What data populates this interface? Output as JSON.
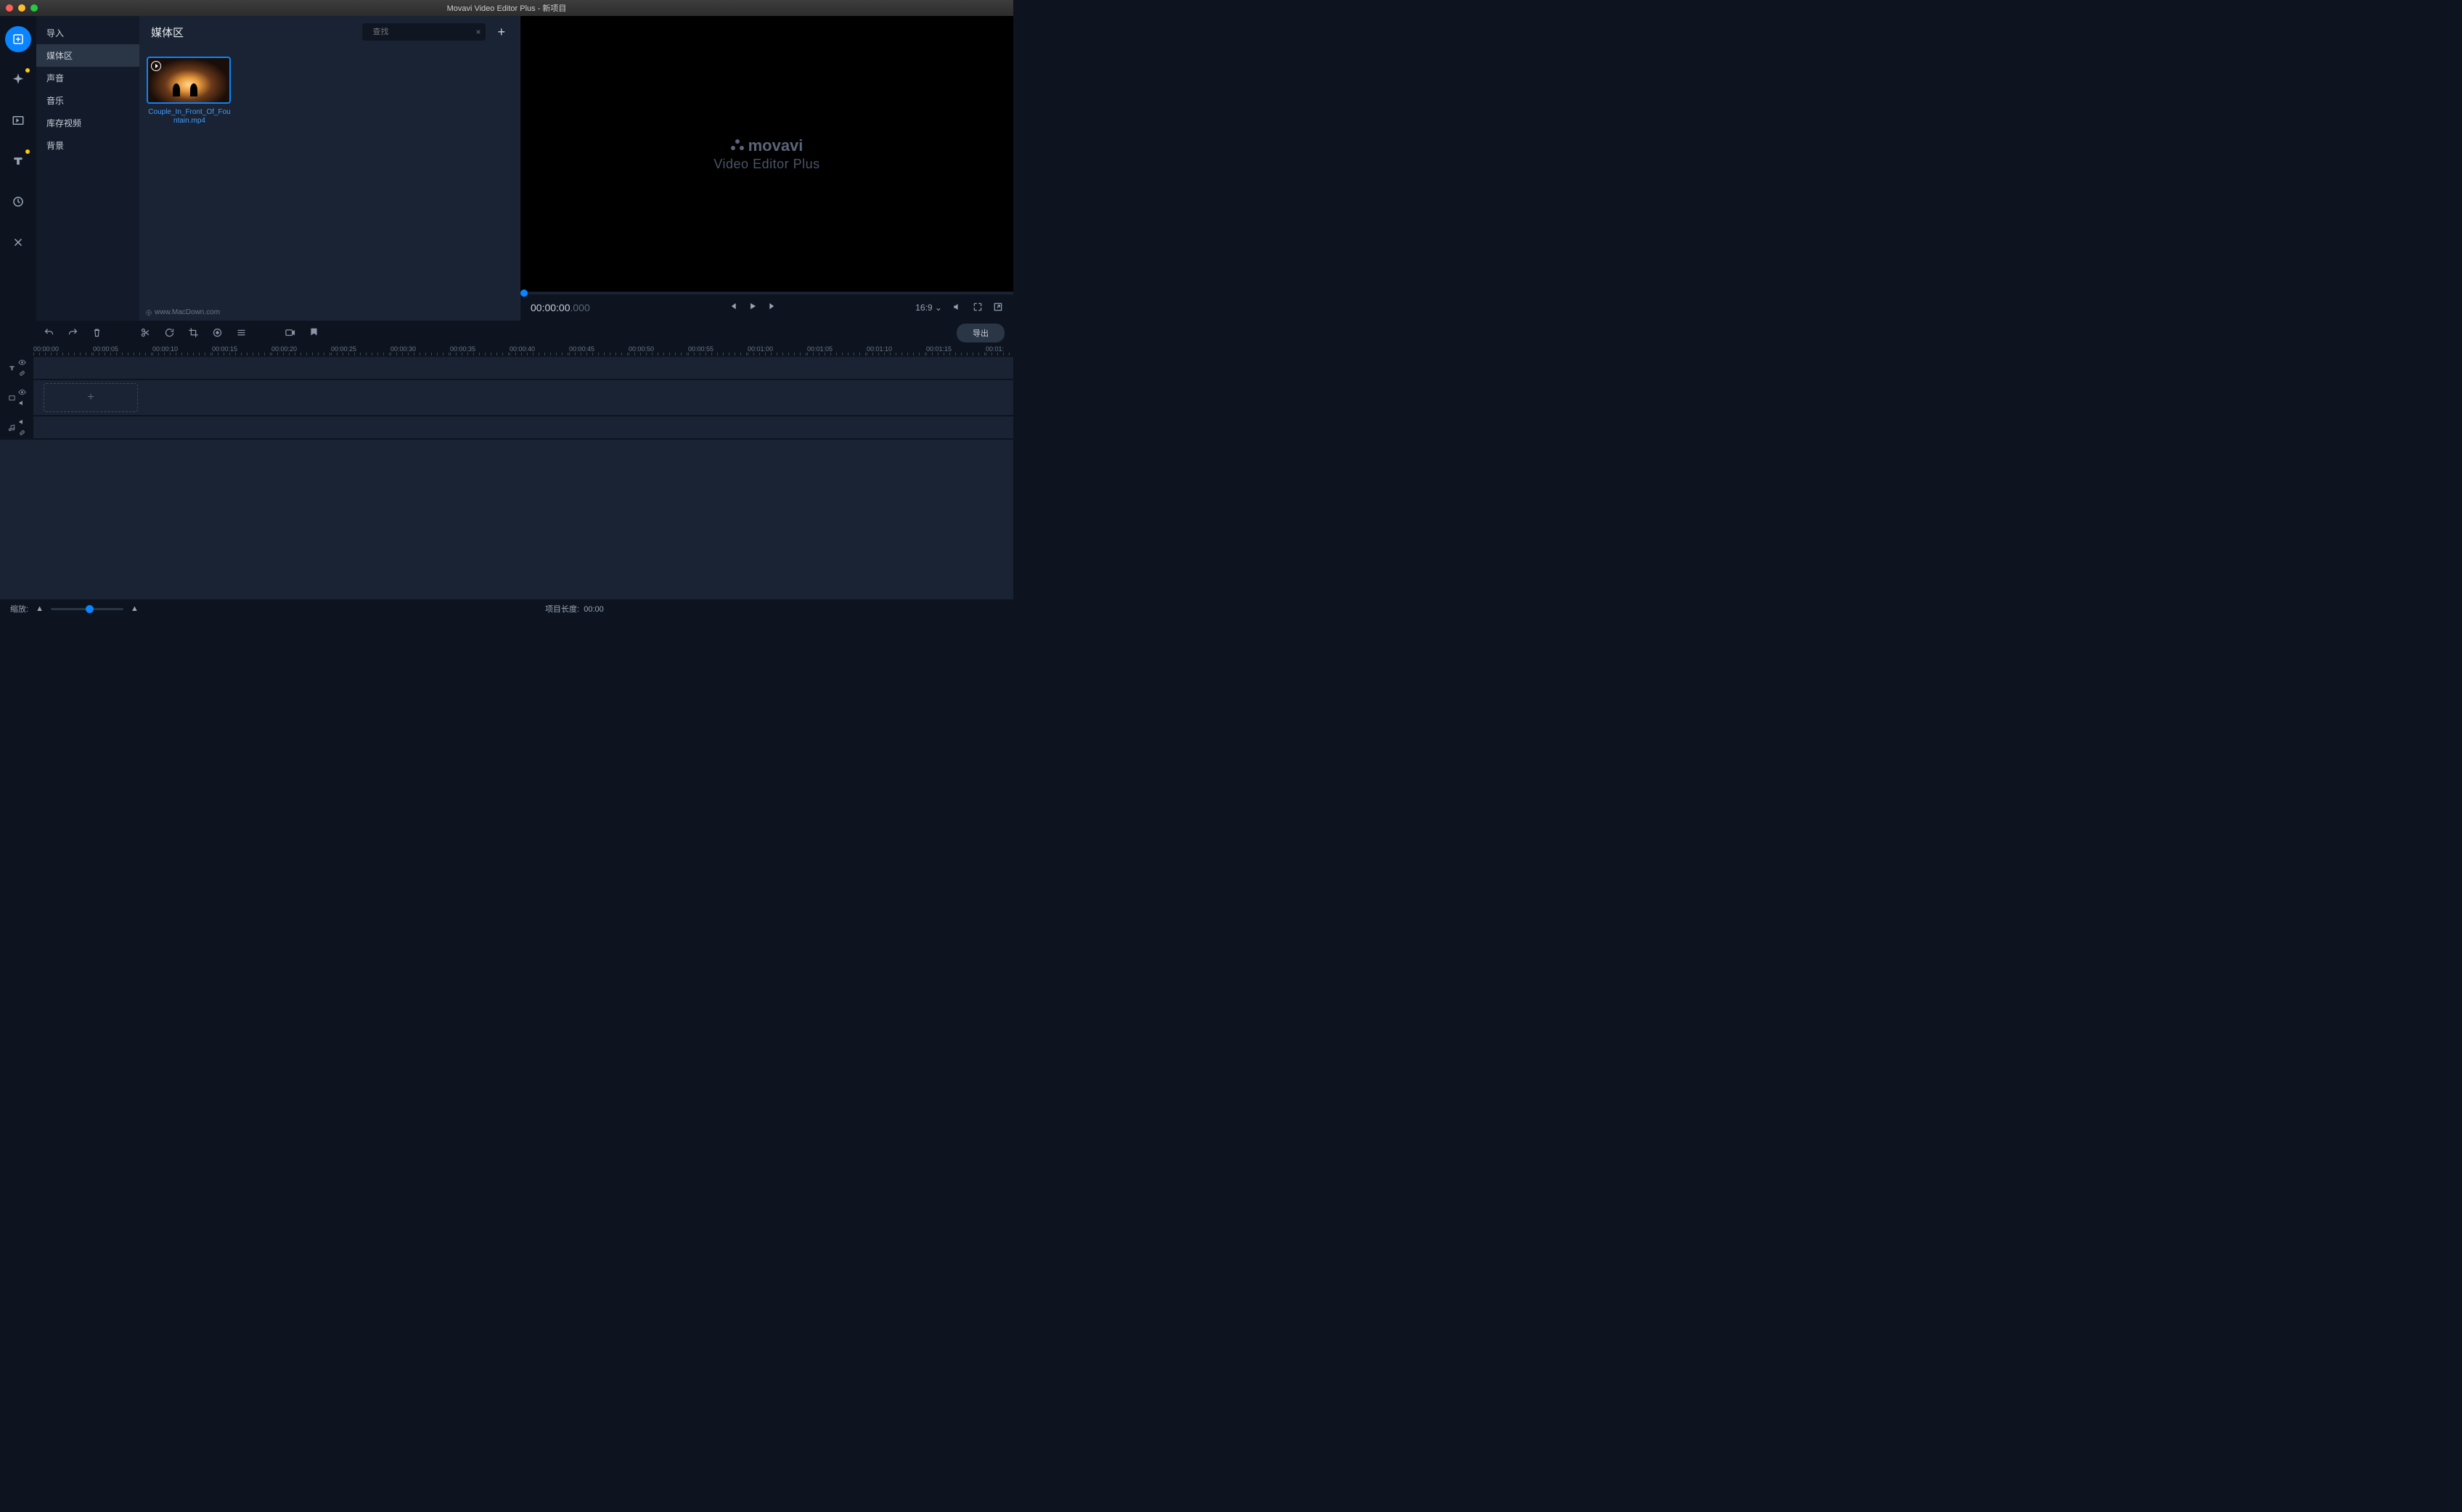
{
  "window": {
    "title": "Movavi Video Editor Plus - 新项目"
  },
  "leftRail": [
    {
      "name": "import-icon",
      "active": true
    },
    {
      "name": "effects-icon",
      "notif": true
    },
    {
      "name": "transitions-icon"
    },
    {
      "name": "titles-icon",
      "notif": true
    },
    {
      "name": "elements-icon"
    },
    {
      "name": "more-tools-icon"
    }
  ],
  "sidebar": {
    "items": [
      {
        "label": "导入",
        "selected": false
      },
      {
        "label": "媒体区",
        "selected": true
      },
      {
        "label": "声音",
        "selected": false
      },
      {
        "label": "音乐",
        "selected": false
      },
      {
        "label": "库存视频",
        "selected": false
      },
      {
        "label": "背景",
        "selected": false
      }
    ]
  },
  "mediaPanel": {
    "title": "媒体区",
    "searchPlaceholder": "查找",
    "items": [
      {
        "filename": "Couple_In_Front_Of_Fountain.mp4"
      }
    ]
  },
  "watermark": "www.MacDown.com",
  "preview": {
    "brand": "movavi",
    "brandSub": "Video Editor Plus",
    "timecode": "00:00:00",
    "timecodeMs": ".000",
    "aspect": "16:9"
  },
  "toolbar": {
    "export": "导出"
  },
  "ruler": [
    "00:00:00",
    "00:00:05",
    "00:00:10",
    "00:00:15",
    "00:00:20",
    "00:00:25",
    "00:00:30",
    "00:00:35",
    "00:00:40",
    "00:00:45",
    "00:00:50",
    "00:00:55",
    "00:01:00",
    "00:01:05",
    "00:01:10",
    "00:01:15",
    "00:01:"
  ],
  "footer": {
    "zoomLabel": "缩放:",
    "projectLengthLabel": "项目长度:",
    "projectLength": "00:00"
  }
}
